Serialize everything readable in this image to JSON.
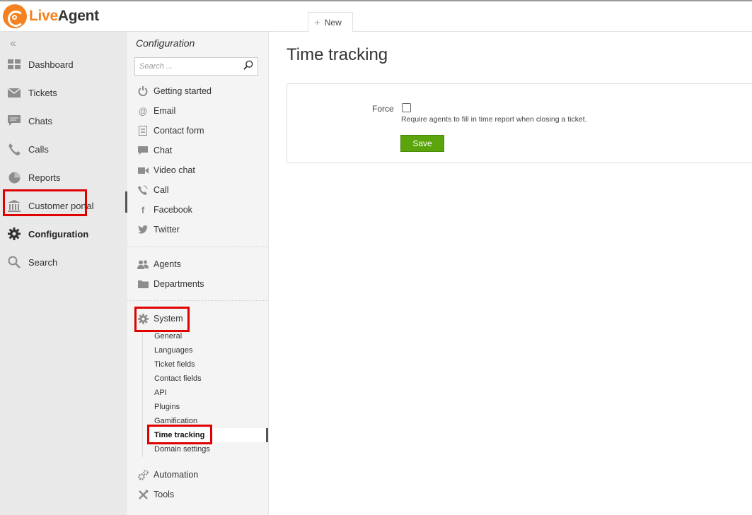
{
  "app": {
    "logo_live": "Live",
    "logo_agent": "Agent",
    "new_tab_label": "New"
  },
  "nav": {
    "items": [
      {
        "label": "Dashboard",
        "icon": "dashboard-icon"
      },
      {
        "label": "Tickets",
        "icon": "envelope-icon"
      },
      {
        "label": "Chats",
        "icon": "chat-bubble-icon"
      },
      {
        "label": "Calls",
        "icon": "phone-icon"
      },
      {
        "label": "Reports",
        "icon": "pie-chart-icon"
      },
      {
        "label": "Customer portal",
        "icon": "building-icon"
      },
      {
        "label": "Configuration",
        "icon": "gear-icon",
        "active": true
      },
      {
        "label": "Search",
        "icon": "search-icon"
      }
    ]
  },
  "config": {
    "title": "Configuration",
    "search_placeholder": "Search ...",
    "channels": [
      {
        "label": "Getting started",
        "icon": "power-icon"
      },
      {
        "label": "Email",
        "icon": "at-icon"
      },
      {
        "label": "Contact form",
        "icon": "form-icon"
      },
      {
        "label": "Chat",
        "icon": "chat-bubble-icon"
      },
      {
        "label": "Video chat",
        "icon": "video-camera-icon"
      },
      {
        "label": "Call",
        "icon": "phone-ringing-icon"
      },
      {
        "label": "Facebook",
        "icon": "facebook-icon"
      },
      {
        "label": "Twitter",
        "icon": "twitter-icon"
      }
    ],
    "people": [
      {
        "label": "Agents",
        "icon": "agents-icon"
      },
      {
        "label": "Departments",
        "icon": "folder-icon"
      }
    ],
    "system_label": "System",
    "system_items": [
      "General",
      "Languages",
      "Ticket fields",
      "Contact fields",
      "API",
      "Plugins",
      "Gamification",
      "Time tracking",
      "Domain settings"
    ],
    "system_current": "Time tracking",
    "automation_label": "Automation",
    "tools_label": "Tools"
  },
  "main": {
    "title": "Time tracking",
    "force_label": "Force",
    "force_checked": false,
    "force_description": "Require agents to fill in time report when closing a ticket.",
    "save_label": "Save"
  },
  "colors": {
    "brand": "#f58220",
    "save": "#5aa50b",
    "highlight": "#e10000"
  }
}
